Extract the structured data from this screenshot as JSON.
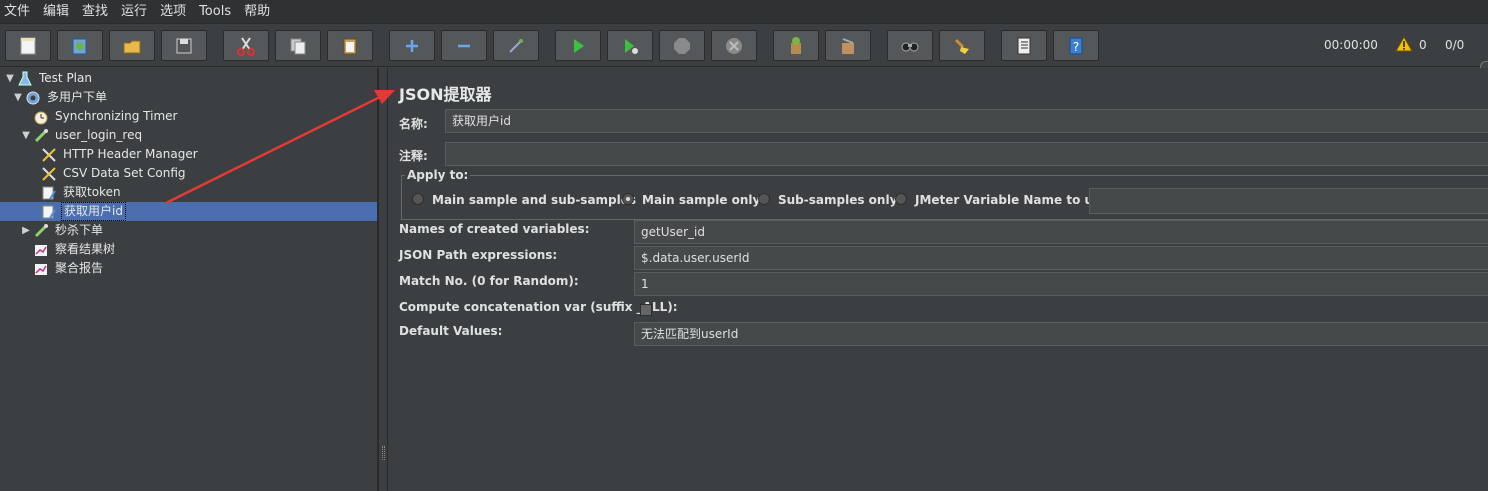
{
  "menu": [
    {
      "label": "文件"
    },
    {
      "label": "编辑"
    },
    {
      "label": "查找"
    },
    {
      "label": "运行"
    },
    {
      "label": "选项"
    },
    {
      "label": "Tools"
    },
    {
      "label": "帮助"
    }
  ],
  "toolbar": {
    "buttons": [
      "new-icon",
      "templates-icon",
      "open-icon",
      "save-icon",
      "cut-icon",
      "copy-icon",
      "paste-icon",
      "expand-icon",
      "collapse-icon",
      "toggle-icon",
      "start-icon",
      "start-no-pause-icon",
      "stop-icon",
      "shutdown-icon",
      "clear-icon",
      "clear-all-icon",
      "search-icon",
      "reset-search-icon",
      "function-helper-icon",
      "help-icon"
    ],
    "timer": "00:00:00",
    "warnings": "0",
    "threads": "0/0"
  },
  "tree": {
    "items": [
      {
        "label": "Test Plan"
      },
      {
        "label": "多用户下单"
      },
      {
        "label": "Synchronizing Timer"
      },
      {
        "label": "user_login_req"
      },
      {
        "label": "HTTP Header Manager"
      },
      {
        "label": "CSV Data Set Config"
      },
      {
        "label": "获取token"
      },
      {
        "label": "获取用户id"
      },
      {
        "label": "秒杀下单"
      },
      {
        "label": "察看结果树"
      },
      {
        "label": "聚合报告"
      }
    ]
  },
  "panel": {
    "title": "JSON提取器",
    "name_label": "名称:",
    "name_value": "获取用户id",
    "comment_label": "注释:",
    "comment_value": "",
    "apply_to": {
      "legend": "Apply to:",
      "options": [
        "Main sample and sub-samples",
        "Main sample only",
        "Sub-samples only",
        "JMeter Variable Name to use"
      ],
      "selected": "Main sample only"
    },
    "fields": [
      {
        "label": "Names of created variables:",
        "value": "getUser_id"
      },
      {
        "label": "JSON Path expressions:",
        "value": "$.data.user.userId"
      },
      {
        "label": "Match No. (0 for Random):",
        "value": "1"
      },
      {
        "label": "Compute concatenation var (suffix _ALL):",
        "value": ""
      },
      {
        "label": "Default Values:",
        "value": "无法匹配到userId"
      }
    ]
  },
  "colors": {
    "background": "#3c3f41",
    "selection": "#4b6eaf",
    "arrow": "#e53935"
  }
}
